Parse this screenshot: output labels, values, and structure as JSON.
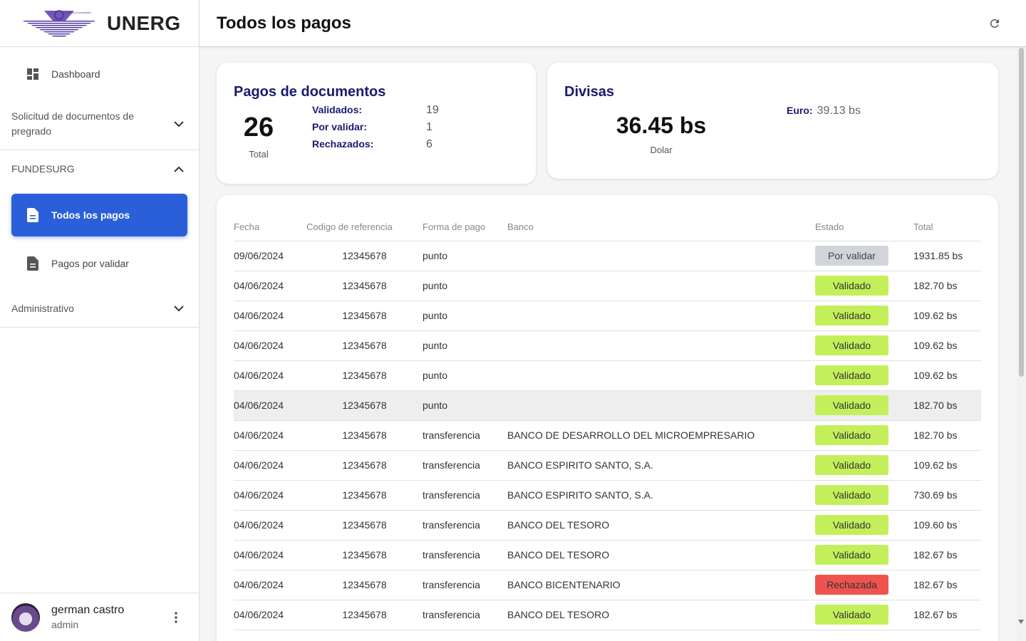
{
  "brand": {
    "name": "UNERG",
    "logo_text": "caminos y horizontes"
  },
  "sidebar": {
    "dashboard": "Dashboard",
    "group1": "Solicitud de documentos de pregrado",
    "group2": "FUNDESURG",
    "active_item": "Todos los pagos",
    "item2": "Pagos por validar",
    "group3": "Administrativo"
  },
  "user": {
    "name": "german castro",
    "role": "admin"
  },
  "header": {
    "title": "Todos los pagos"
  },
  "stats": {
    "title": "Pagos de documentos",
    "total": "26",
    "total_label": "Total",
    "rows": [
      {
        "label": "Validados:",
        "value": "19"
      },
      {
        "label": "Por validar:",
        "value": "1"
      },
      {
        "label": "Rechazados:",
        "value": "6"
      }
    ]
  },
  "divisas": {
    "title": "Divisas",
    "dolar_value": "36.45 bs",
    "dolar_label": "Dolar",
    "euro_label": "Euro:",
    "euro_value": "39.13 bs"
  },
  "table": {
    "headers": [
      "Fecha",
      "Codigo de referencia",
      "Forma de pago",
      "Banco",
      "Estado",
      "Total"
    ],
    "rows": [
      [
        "09/06/2024",
        "12345678",
        "punto",
        "",
        "Por validar",
        "1931.85 bs"
      ],
      [
        "04/06/2024",
        "12345678",
        "punto",
        "",
        "Validado",
        "182.70 bs"
      ],
      [
        "04/06/2024",
        "12345678",
        "punto",
        "",
        "Validado",
        "109.62 bs"
      ],
      [
        "04/06/2024",
        "12345678",
        "punto",
        "",
        "Validado",
        "109.62 bs"
      ],
      [
        "04/06/2024",
        "12345678",
        "punto",
        "",
        "Validado",
        "109.62 bs"
      ],
      [
        "04/06/2024",
        "12345678",
        "punto",
        "",
        "Validado",
        "182.70 bs"
      ],
      [
        "04/06/2024",
        "12345678",
        "transferencia",
        "BANCO DE DESARROLLO DEL MICROEMPRESARIO",
        "Validado",
        "182.70 bs"
      ],
      [
        "04/06/2024",
        "12345678",
        "transferencia",
        "BANCO ESPIRITO SANTO, S.A.",
        "Validado",
        "109.62 bs"
      ],
      [
        "04/06/2024",
        "12345678",
        "transferencia",
        "BANCO ESPIRITO SANTO, S.A.",
        "Validado",
        "730.69 bs"
      ],
      [
        "04/06/2024",
        "12345678",
        "transferencia",
        "BANCO DEL TESORO",
        "Validado",
        "109.60 bs"
      ],
      [
        "04/06/2024",
        "12345678",
        "transferencia",
        "BANCO DEL TESORO",
        "Validado",
        "182.67 bs"
      ],
      [
        "04/06/2024",
        "12345678",
        "transferencia",
        "BANCO BICENTENARIO",
        "Rechazada",
        "182.67 bs"
      ],
      [
        "04/06/2024",
        "12345678",
        "transferencia",
        "BANCO DEL TESORO",
        "Validado",
        "182.67 bs"
      ]
    ],
    "highlighted_row": 5
  },
  "colors": {
    "primary": "#2b5fd9",
    "title_navy": "#1a1a6e",
    "valid": "#c3f05a",
    "pending": "#d1d5db",
    "rejected": "#ef5350"
  }
}
